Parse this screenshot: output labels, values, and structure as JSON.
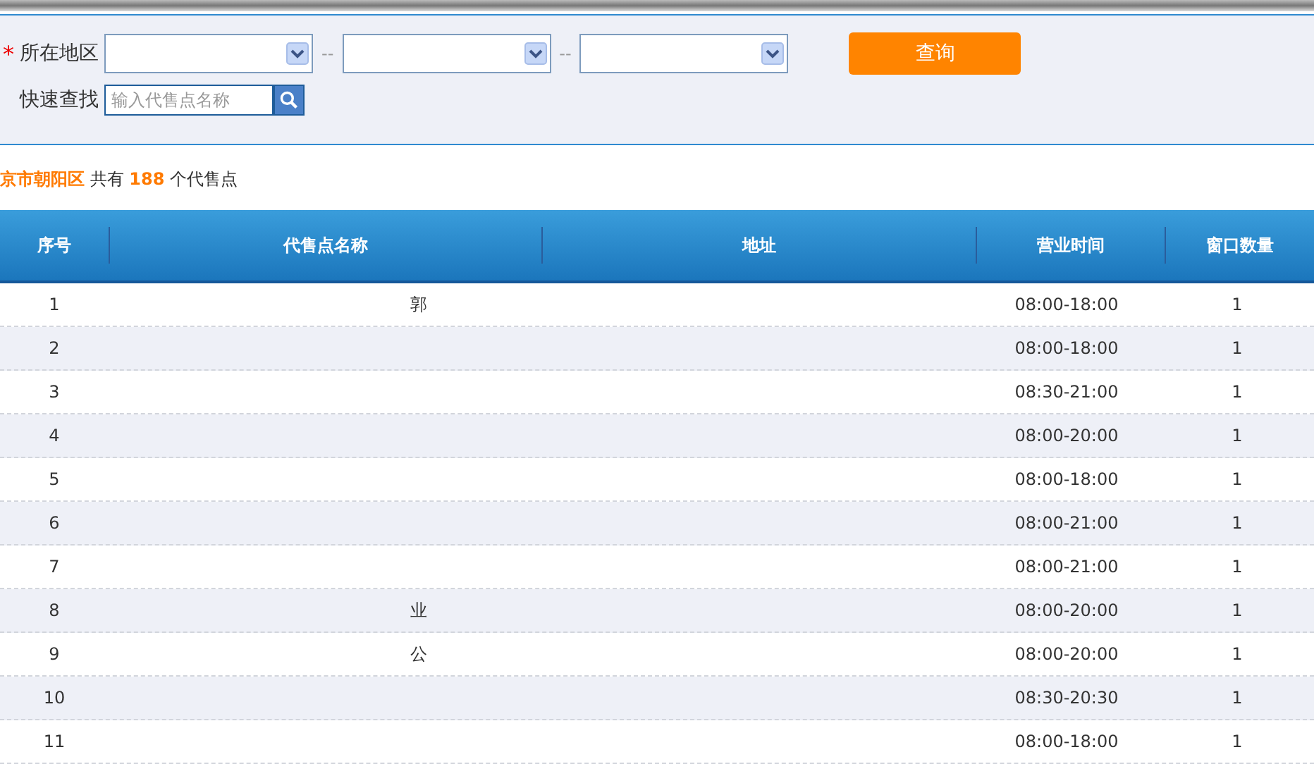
{
  "filter": {
    "region_label": "所在地区",
    "required_mark": "*",
    "select_separators": [
      "--",
      "--"
    ],
    "query_button": "查询",
    "search_label": "快速查找",
    "search": {
      "placeholder": "输入代售点名称"
    }
  },
  "summary": {
    "region": "京市朝阳区",
    "prefix": "共有",
    "count": "188",
    "suffix": "个代售点"
  },
  "table": {
    "columns": [
      "序号",
      "代售点名称",
      "地址",
      "营业时间",
      "窗口数量"
    ],
    "rows": [
      {
        "no": "1",
        "name": "郭",
        "hours": "08:00-18:00",
        "windows": "1"
      },
      {
        "no": "2",
        "hours": "08:00-18:00",
        "windows": "1"
      },
      {
        "no": "3",
        "hours": "08:30-21:00",
        "windows": "1"
      },
      {
        "no": "4",
        "hours": "08:00-20:00",
        "windows": "1"
      },
      {
        "no": "5",
        "hours": "08:00-18:00",
        "windows": "1"
      },
      {
        "no": "6",
        "hours": "08:00-21:00",
        "windows": "1"
      },
      {
        "no": "7",
        "hours": "08:00-21:00",
        "windows": "1"
      },
      {
        "no": "8",
        "name": "业",
        "hours": "08:00-20:00",
        "windows": "1"
      },
      {
        "no": "9",
        "name": "公",
        "hours": "08:00-20:00",
        "windows": "1"
      },
      {
        "no": "10",
        "hours": "08:30-20:30",
        "windows": "1"
      },
      {
        "no": "11",
        "hours": "08:00-18:00",
        "windows": "1"
      }
    ]
  }
}
